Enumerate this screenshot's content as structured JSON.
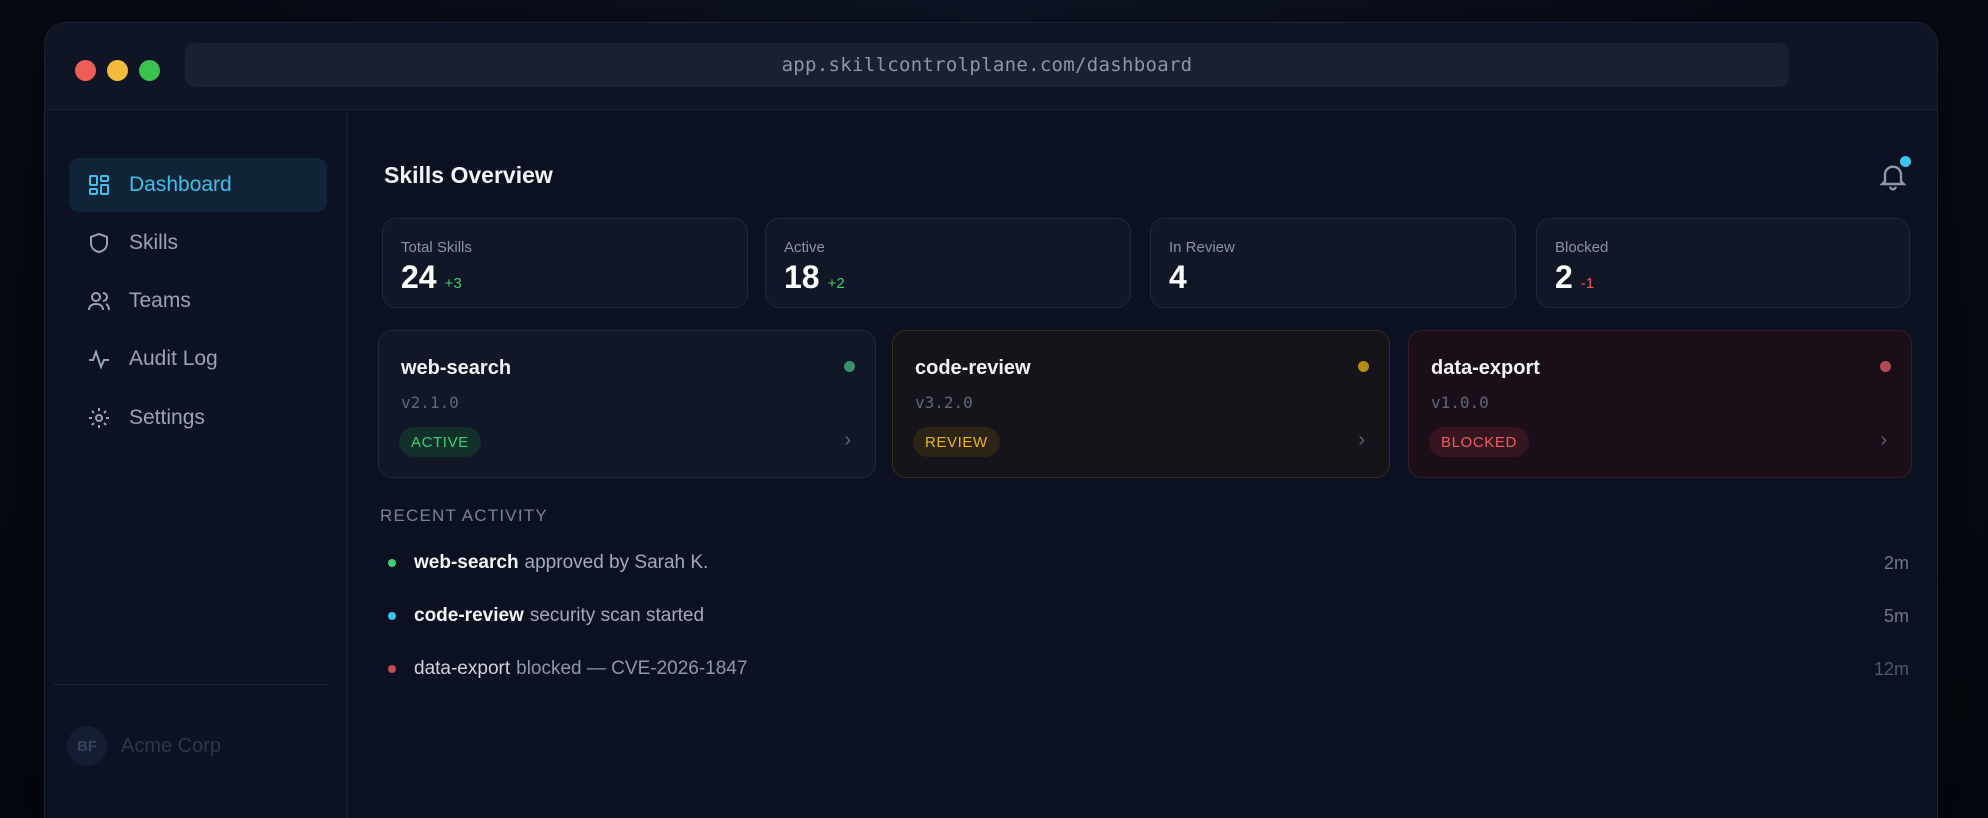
{
  "browser": {
    "url": "app.skillcontrolplane.com/dashboard"
  },
  "sidebar": {
    "items": [
      {
        "label": "Dashboard",
        "icon": "dashboard-grid-icon",
        "active": true
      },
      {
        "label": "Skills",
        "icon": "shield-icon",
        "active": false
      },
      {
        "label": "Teams",
        "icon": "users-icon",
        "active": false
      },
      {
        "label": "Audit Log",
        "icon": "activity-pulse-icon",
        "active": false
      },
      {
        "label": "Settings",
        "icon": "gear-icon",
        "active": false
      }
    ],
    "org": {
      "initials": "BF",
      "name": "Acme Corp"
    }
  },
  "main": {
    "title": "Skills Overview",
    "notification_icon": "bell-icon",
    "stats": [
      {
        "label": "Total Skills",
        "value": "24",
        "delta": "+3",
        "trend": "up"
      },
      {
        "label": "Active",
        "value": "18",
        "delta": "+2",
        "trend": "up"
      },
      {
        "label": "In Review",
        "value": "4",
        "delta": "",
        "trend": "none"
      },
      {
        "label": "Blocked",
        "value": "2",
        "delta": "-1",
        "trend": "down"
      }
    ],
    "skills": [
      {
        "name": "web-search",
        "version": "v2.1.0",
        "status": "ACTIVE",
        "color": "#3ecf72"
      },
      {
        "name": "code-review",
        "version": "v3.2.0",
        "status": "REVIEW",
        "color": "#e8b424"
      },
      {
        "name": "data-export",
        "version": "v1.0.0",
        "status": "BLOCKED",
        "color": "#ee5d61"
      }
    ],
    "activity_heading": "RECENT ACTIVITY",
    "activity": [
      {
        "skill": "web-search",
        "text": "approved by Sarah K.",
        "time": "2m",
        "color": "#3ecf72"
      },
      {
        "skill": "code-review",
        "text": "security scan started",
        "time": "5m",
        "color": "#38c6ee"
      },
      {
        "skill": "data-export",
        "text": "blocked — CVE-2026-1847",
        "time": "12m",
        "color": "#ee5d61"
      }
    ]
  },
  "colors": {
    "accent": "#3fc0e8",
    "background": "#0b1120"
  }
}
